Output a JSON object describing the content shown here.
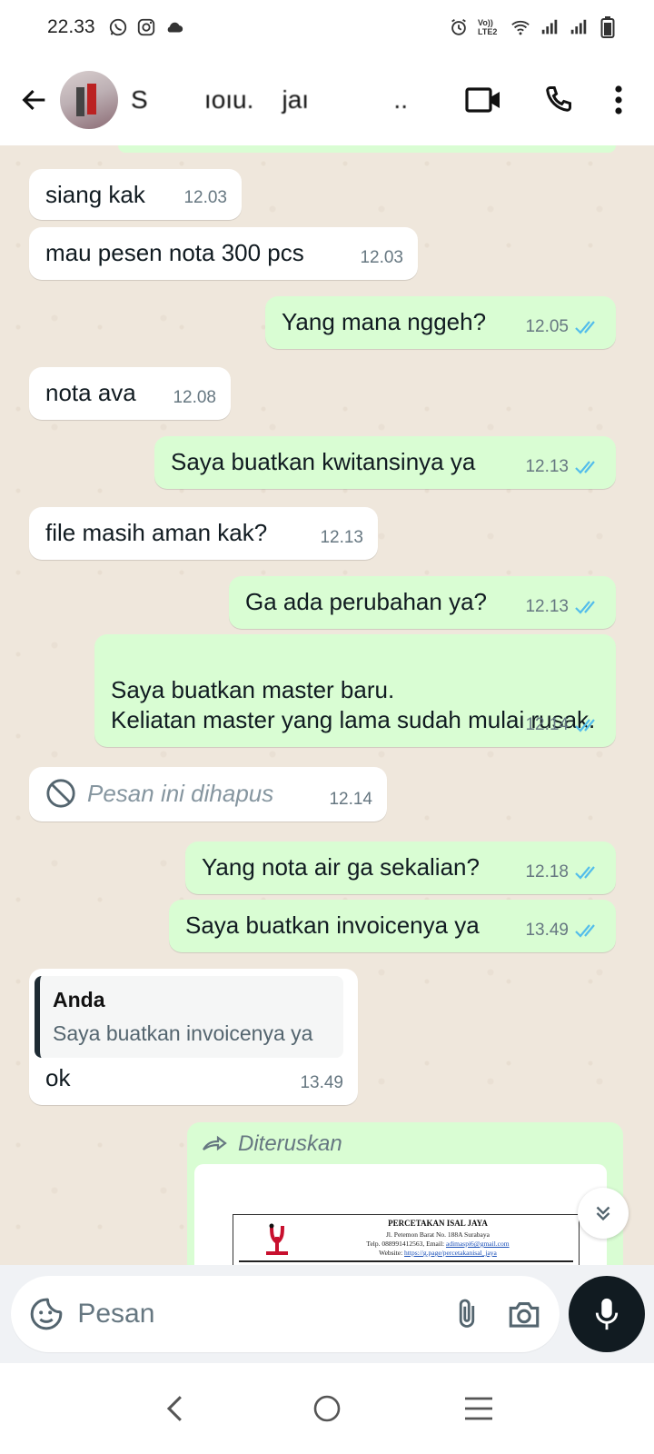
{
  "status_bar": {
    "time": "22.33",
    "network_label": "Vo)) LTE2"
  },
  "header": {
    "contact_name": "S        ıoıu.    jaı            .."
  },
  "messages": [
    {
      "id": "m1",
      "dir": "in",
      "text": "siang kak",
      "time": "12.03"
    },
    {
      "id": "m2",
      "dir": "in",
      "text": "mau pesen nota 300 pcs",
      "time": "12.03"
    },
    {
      "id": "m3",
      "dir": "out",
      "text": "Yang mana nggeh?",
      "time": "12.05"
    },
    {
      "id": "m4",
      "dir": "in",
      "text": "nota ava",
      "time": "12.08"
    },
    {
      "id": "m5",
      "dir": "out",
      "text": "Saya buatkan kwitansinya ya",
      "time": "12.13"
    },
    {
      "id": "m6",
      "dir": "in",
      "text": "file masih aman kak?",
      "time": "12.13"
    },
    {
      "id": "m7",
      "dir": "out",
      "text": "Ga ada perubahan ya?",
      "time": "12.13"
    },
    {
      "id": "m8",
      "dir": "out",
      "text": "Saya buatkan master baru.\nKeliatan master yang lama sudah mulai rusak.",
      "time": "12.14"
    },
    {
      "id": "m9",
      "dir": "in",
      "text": "Pesan ini dihapus",
      "time": "12.14",
      "deleted": true
    },
    {
      "id": "m10",
      "dir": "out",
      "text": "Yang nota air ga sekalian?",
      "time": "12.18"
    },
    {
      "id": "m11",
      "dir": "out",
      "text": "Saya buatkan invoicenya ya",
      "time": "13.49"
    },
    {
      "id": "m12",
      "dir": "in",
      "text": "ok",
      "time": "13.49",
      "quote": {
        "author": "Anda",
        "text": "Saya buatkan invoicenya ya"
      }
    }
  ],
  "forwarded": {
    "label": "Diteruskan",
    "doc_title": "PERCETAKAN ISAL JAYA",
    "doc_address": "Jl. Petemon Barat No. 188A Surabaya",
    "doc_contact_prefix": "Telp. 088991412563, Email: ",
    "doc_email": "adimaspi6@gmail.com",
    "doc_website_prefix": "Website: ",
    "doc_website": "https://g.page/percetakanisal_jaya"
  },
  "input": {
    "placeholder": "Pesan"
  },
  "colors": {
    "outgoing_bubble": "#d9fdd3",
    "incoming_bubble": "#ffffff",
    "read_tick": "#53bdeb",
    "mic_button": "#111b21"
  }
}
